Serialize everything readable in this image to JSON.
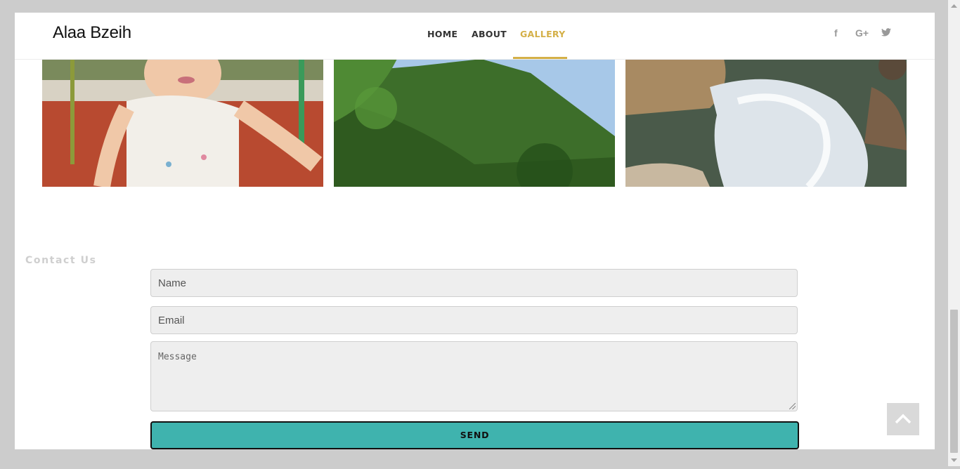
{
  "header": {
    "brand": "Alaa Bzeih",
    "nav": [
      {
        "label": "HOME",
        "active": false
      },
      {
        "label": "ABOUT",
        "active": false
      },
      {
        "label": "GALLERY",
        "active": true
      }
    ],
    "accent_color": "#d4b048",
    "social": [
      {
        "icon": "facebook-icon",
        "glyph": "f"
      },
      {
        "icon": "google-plus-icon",
        "glyph": "G+"
      },
      {
        "icon": "twitter-icon",
        "glyph": "🐦"
      }
    ]
  },
  "gallery": {
    "images": [
      {
        "subject": "toddler-photo"
      },
      {
        "subject": "green-mountain-photo"
      },
      {
        "subject": "waterfall-photo"
      }
    ]
  },
  "contact": {
    "title": "Contact Us",
    "name_placeholder": "Name",
    "email_placeholder": "Email",
    "message_placeholder": "Message",
    "send_label": "SEND",
    "button_color": "#3fb3ae"
  }
}
